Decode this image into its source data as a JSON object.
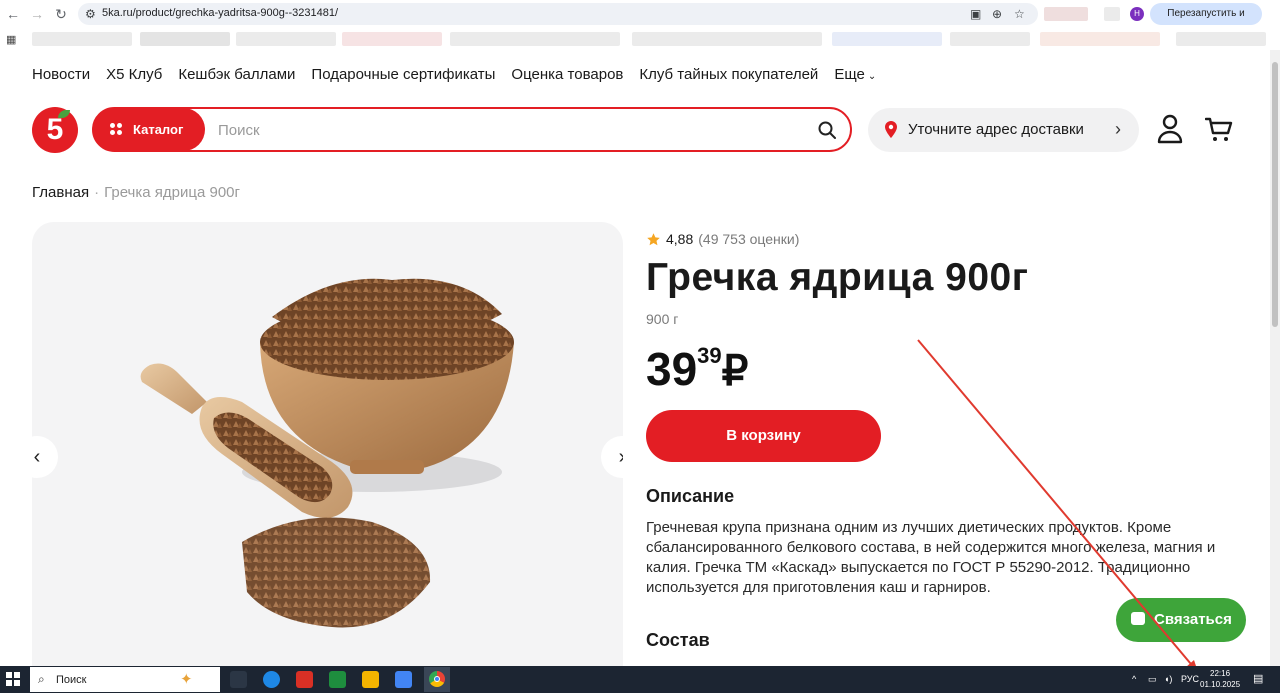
{
  "browser": {
    "url": "5ka.ru/product/grechka-yadritsa-900g--3231481/",
    "restart_label": "Перезапустить и обновить",
    "profile_initial": "Н"
  },
  "topmenu": {
    "items": [
      "Новости",
      "X5 Клуб",
      "Кешбэк баллами",
      "Подарочные сертификаты",
      "Оценка товаров",
      "Клуб тайных покупателей"
    ],
    "more_label": "Еще"
  },
  "header": {
    "logo_text": "5",
    "catalog_label": "Каталог",
    "search_placeholder": "Поиск",
    "address_label": "Уточните адрес доставки"
  },
  "breadcrumb": {
    "home": "Главная",
    "separator": "·",
    "current": "Гречка ядрица 900г"
  },
  "product": {
    "rating": "4,88",
    "reviews": "(49 753 оценки)",
    "title": "Гречка ядрица 900г",
    "weight": "900 г",
    "price_rub": "39",
    "price_kop": "39",
    "currency": "₽",
    "add_to_cart": "В корзину",
    "description_title": "Описание",
    "description": "Гречневая крупа признана одним из лучших диетических продуктов. Кроме сбалансированного белкового состава, в ней содержится много железа, магния и калия. Гречка ТМ «Каскад» выпускается по ГОСТ Р 55290-2012. Традиционно используется для приготовления каш и гарниров.",
    "composition_title": "Состав"
  },
  "chat": {
    "label": "Связаться"
  },
  "taskbar": {
    "search_label": "Поиск",
    "lang": "РУС",
    "time": "22:16",
    "date": "01.10.2025"
  },
  "colors": {
    "brand_red": "#e31e24",
    "chat_green": "#3ea53a",
    "taskbar": "#1c2532"
  }
}
